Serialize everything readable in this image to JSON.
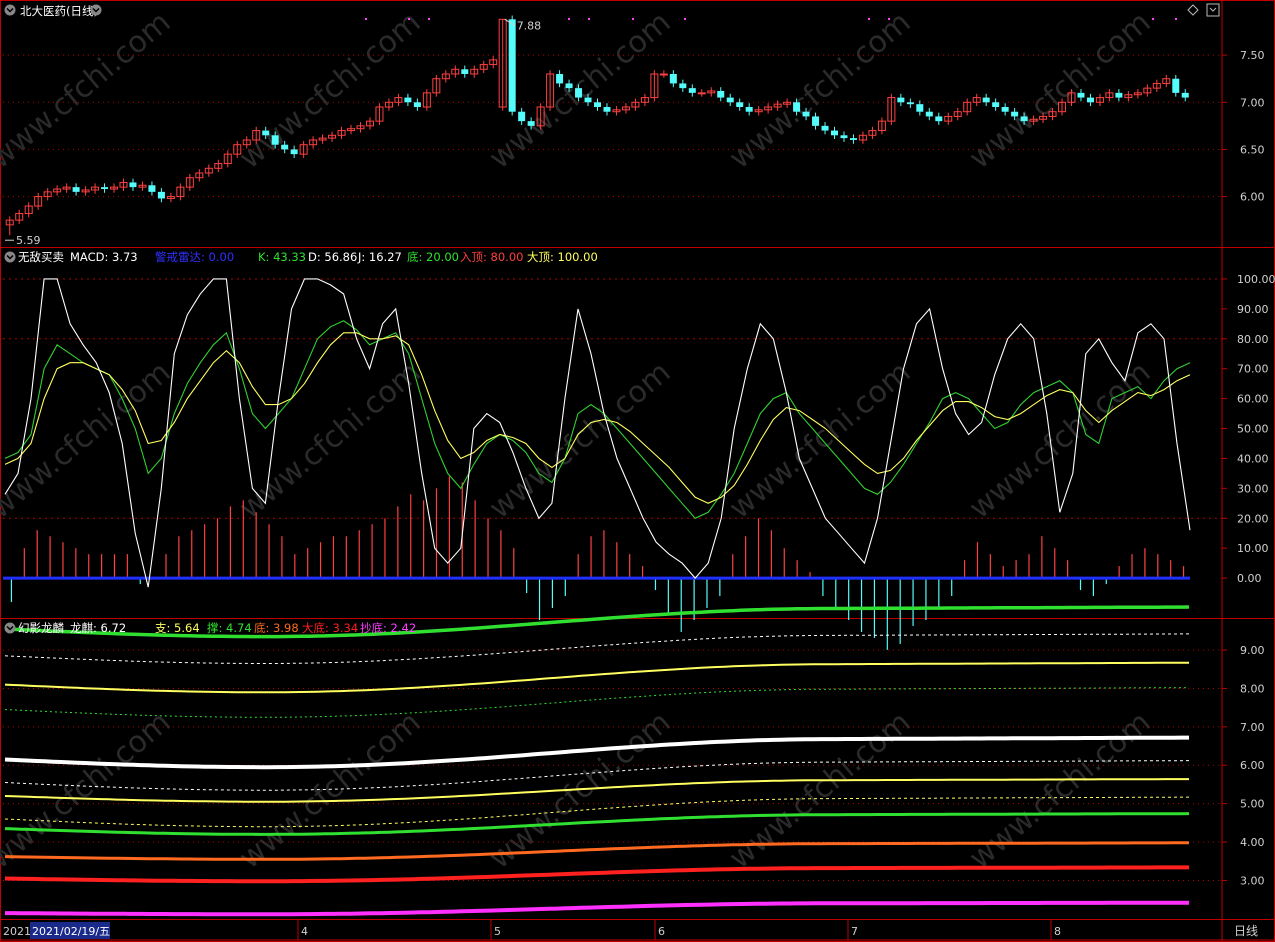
{
  "header": {
    "stock_title": "北大医药(日线)",
    "period_tab": "日线"
  },
  "panel1": {
    "yticks": [
      "7.50",
      "7.00",
      "6.50",
      "6.00"
    ],
    "high_label": "7.88",
    "low_label": "5.59"
  },
  "panel2": {
    "title": "无敌买卖",
    "labels": [
      {
        "text": "MACD: 3.73",
        "color": "#ffffff"
      },
      {
        "text": "警戒雷达: 0.00",
        "color": "#3030ff"
      },
      {
        "text": "K: 43.33",
        "color": "#30e030"
      },
      {
        "text": "D: 56.86",
        "color": "#ffffff"
      },
      {
        "text": "J: 16.27",
        "color": "#ffffff"
      },
      {
        "text": "底: 20.00",
        "color": "#30e030"
      },
      {
        "text": "入顶: 80.00",
        "color": "#ff4040"
      },
      {
        "text": "大顶: 100.00",
        "color": "#ffff60"
      }
    ],
    "yticks": [
      "100.00",
      "90.00",
      "80.00",
      "70.00",
      "60.00",
      "50.00",
      "40.00",
      "30.00",
      "20.00",
      "10.00",
      "0.00"
    ]
  },
  "panel3": {
    "title": "幻影龙麟",
    "labels": [
      {
        "text": "龙麒: 6.72",
        "color": "#ffffff"
      },
      {
        "text": "支: 5.64",
        "color": "#ffff60"
      },
      {
        "text": "撑: 4.74",
        "color": "#30e030"
      },
      {
        "text": "底: 3.98",
        "color": "#ff6a20"
      },
      {
        "text": "大底: 3.34",
        "color": "#ff2020"
      },
      {
        "text": "抄底: 2.42",
        "color": "#ff40ff"
      }
    ],
    "yticks": [
      "9.00",
      "8.00",
      "7.00",
      "6.00",
      "5.00",
      "4.00",
      "3.00"
    ]
  },
  "xaxis": {
    "start_label": "2021",
    "cursor_date": "2021/02/19/五",
    "month_labels": [
      "4",
      "5",
      "6",
      "7",
      "8"
    ]
  },
  "watermark": "www.cfchi.com",
  "colors": {
    "up": "#ff4040",
    "down": "#54fcfc",
    "frame": "#c00000",
    "grid": "#b00000"
  },
  "chart_data": [
    {
      "type": "candlestick",
      "title": "北大医药(日线)",
      "ylim": [
        5.55,
        8.0
      ],
      "high": 7.88,
      "low": 5.59,
      "close_series": [
        5.75,
        5.82,
        5.9,
        6.0,
        6.05,
        6.08,
        6.1,
        6.05,
        6.07,
        6.1,
        6.08,
        6.1,
        6.15,
        6.1,
        6.12,
        6.05,
        5.98,
        6.0,
        6.1,
        6.2,
        6.25,
        6.3,
        6.35,
        6.45,
        6.55,
        6.6,
        6.7,
        6.65,
        6.55,
        6.5,
        6.45,
        6.55,
        6.6,
        6.62,
        6.65,
        6.7,
        6.72,
        6.75,
        6.8,
        6.95,
        7.0,
        7.05,
        7.0,
        6.95,
        7.1,
        7.25,
        7.3,
        7.35,
        7.3,
        7.35,
        7.4,
        7.45,
        7.88,
        6.9,
        6.8,
        6.75,
        6.95,
        7.3,
        7.2,
        7.15,
        7.05,
        7.0,
        6.95,
        6.9,
        6.92,
        6.95,
        7.0,
        7.05,
        7.3,
        7.3,
        7.2,
        7.15,
        7.1,
        7.1,
        7.12,
        7.05,
        7.0,
        6.95,
        6.9,
        6.92,
        6.95,
        6.98,
        7.0,
        6.9,
        6.85,
        6.75,
        6.7,
        6.65,
        6.62,
        6.6,
        6.65,
        6.7,
        6.8,
        7.05,
        7.0,
        6.98,
        6.9,
        6.85,
        6.8,
        6.85,
        6.9,
        7.0,
        7.05,
        7.0,
        6.95,
        6.9,
        6.85,
        6.8,
        6.82,
        6.85,
        6.9,
        7.0,
        7.1,
        7.05,
        7.0,
        7.05,
        7.1,
        7.05,
        7.08,
        7.1,
        7.15,
        7.2,
        7.25,
        7.1,
        7.05
      ]
    },
    {
      "type": "line",
      "title": "无敌买卖",
      "ylim": [
        -12,
        107
      ],
      "reference_lines": [
        20,
        80,
        100
      ],
      "series": [
        {
          "name": "K",
          "values": [
            40,
            42,
            48,
            70,
            78,
            75,
            72,
            70,
            68,
            60,
            50,
            35,
            40,
            55,
            65,
            72,
            78,
            82,
            70,
            55,
            50,
            55,
            60,
            70,
            80,
            84,
            86,
            83,
            78,
            80,
            82,
            75,
            60,
            45,
            35,
            30,
            38,
            45,
            48,
            46,
            42,
            35,
            32,
            40,
            55,
            58,
            55,
            50,
            45,
            40,
            35,
            30,
            25,
            20,
            22,
            28,
            35,
            45,
            55,
            60,
            62,
            55,
            50,
            45,
            40,
            35,
            30,
            28,
            32,
            38,
            45,
            52,
            60,
            62,
            60,
            55,
            50,
            52,
            58,
            62,
            64,
            66,
            62,
            48,
            45,
            60,
            62,
            64,
            60,
            66,
            70,
            72
          ]
        },
        {
          "name": "D",
          "values": [
            38,
            40,
            45,
            60,
            70,
            72,
            72,
            70,
            68,
            63,
            56,
            45,
            46,
            52,
            60,
            66,
            72,
            76,
            72,
            64,
            58,
            58,
            60,
            65,
            72,
            78,
            82,
            82,
            80,
            80,
            81,
            78,
            68,
            56,
            46,
            40,
            42,
            46,
            48,
            47,
            45,
            40,
            37,
            40,
            48,
            52,
            53,
            52,
            49,
            45,
            41,
            37,
            32,
            27,
            25,
            27,
            31,
            38,
            46,
            53,
            57,
            56,
            53,
            50,
            46,
            42,
            38,
            35,
            36,
            40,
            46,
            51,
            56,
            59,
            59,
            57,
            54,
            53,
            55,
            58,
            61,
            63,
            62,
            56,
            52,
            56,
            59,
            62,
            61,
            63,
            66,
            68
          ]
        },
        {
          "name": "J",
          "values": [
            28,
            35,
            60,
            100,
            100,
            85,
            78,
            72,
            62,
            45,
            15,
            -3,
            30,
            75,
            88,
            95,
            100,
            100,
            60,
            30,
            25,
            60,
            90,
            100,
            100,
            98,
            95,
            80,
            70,
            85,
            90,
            65,
            35,
            10,
            5,
            10,
            50,
            55,
            52,
            42,
            30,
            20,
            25,
            60,
            90,
            75,
            55,
            40,
            30,
            20,
            12,
            8,
            5,
            0,
            5,
            20,
            50,
            70,
            85,
            80,
            62,
            40,
            30,
            20,
            15,
            10,
            5,
            20,
            45,
            70,
            85,
            90,
            70,
            55,
            48,
            52,
            68,
            80,
            85,
            80,
            55,
            22,
            35,
            75,
            80,
            72,
            66,
            82,
            85,
            80,
            45,
            16
          ]
        }
      ],
      "macd": [
        -8,
        10,
        16,
        14,
        12,
        10,
        8,
        8,
        8,
        8,
        -2,
        0,
        8,
        14,
        16,
        18,
        20,
        24,
        26,
        22,
        18,
        14,
        8,
        10,
        12,
        14,
        14,
        16,
        18,
        20,
        24,
        28,
        26,
        30,
        34,
        32,
        26,
        20,
        16,
        10,
        -5,
        -14,
        -10,
        -6,
        8,
        14,
        16,
        12,
        8,
        4,
        -4,
        -12,
        -18,
        -14,
        -10,
        -6,
        8,
        14,
        20,
        16,
        10,
        6,
        2,
        -6,
        -10,
        -14,
        -18,
        -20,
        -24,
        -22,
        -16,
        -14,
        -10,
        -6,
        6,
        12,
        8,
        4,
        6,
        8,
        14,
        10,
        6,
        -4,
        -6,
        -2,
        4,
        8,
        10,
        8,
        6,
        4
      ]
    },
    {
      "type": "line",
      "title": "幻影龙麟",
      "ylim": [
        2.1,
        9.6
      ],
      "series": [
        {
          "name": "龙麒",
          "start": 6.15,
          "dip": 5.95,
          "end": 6.72
        },
        {
          "name": "支",
          "start": 5.2,
          "dip": 5.05,
          "end": 5.64
        },
        {
          "name": "撑",
          "start": 4.35,
          "dip": 4.2,
          "end": 4.74
        },
        {
          "name": "底",
          "start": 3.62,
          "dip": 3.55,
          "end": 3.98
        },
        {
          "name": "大底",
          "start": 3.05,
          "dip": 2.98,
          "end": 3.34
        },
        {
          "name": "抄底",
          "start": 2.15,
          "dip": 2.12,
          "end": 2.42
        }
      ]
    }
  ]
}
